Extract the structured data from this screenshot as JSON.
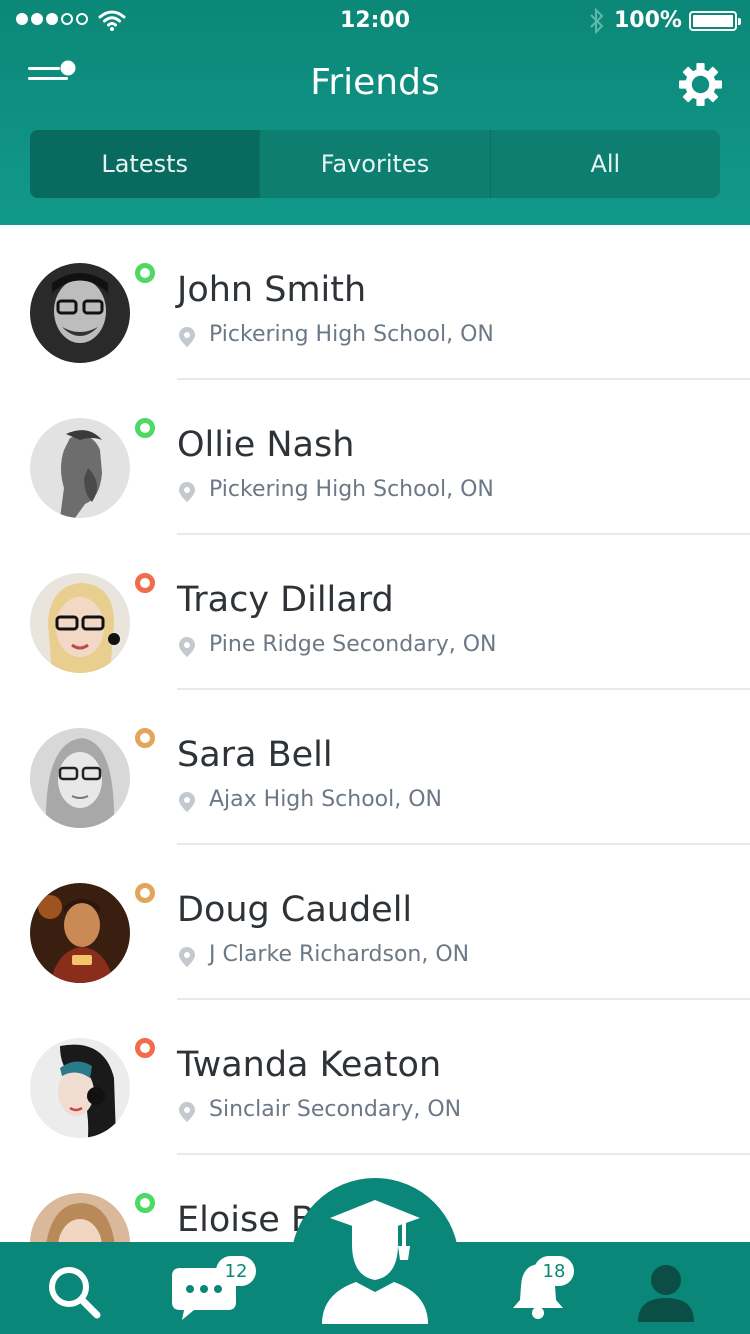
{
  "status_bar": {
    "time": "12:00",
    "battery_percent": "100%",
    "signal_bars_filled": 3,
    "signal_bars_total": 5
  },
  "header": {
    "title": "Friends",
    "menu_icon": "menu-icon",
    "settings_icon": "gear-icon"
  },
  "tabs": [
    {
      "label": "Latests",
      "active": true
    },
    {
      "label": "Favorites",
      "active": false
    },
    {
      "label": "All",
      "active": false
    }
  ],
  "friends": [
    {
      "name": "John Smith",
      "location": "Pickering High School, ON",
      "status_color": "#4cd964"
    },
    {
      "name": "Ollie Nash",
      "location": "Pickering High School, ON",
      "status_color": "#4cd964"
    },
    {
      "name": "Tracy Dillard",
      "location": "Pine Ridge Secondary, ON",
      "status_color": "#f26b4a"
    },
    {
      "name": "Sara Bell",
      "location": "Ajax High School, ON",
      "status_color": "#e2a55a"
    },
    {
      "name": "Doug Caudell",
      "location": "J Clarke Richardson, ON",
      "status_color": "#e2a55a"
    },
    {
      "name": "Twanda Keaton",
      "location": "Sinclair Secondary, ON",
      "status_color": "#f26b4a"
    },
    {
      "name": "Eloise B",
      "location": "",
      "status_color": "#4cd964"
    }
  ],
  "bottom_nav": {
    "search_icon": "search-icon",
    "messages_icon": "chat-icon",
    "messages_badge": "12",
    "center_icon": "graduate-icon",
    "notifications_icon": "bell-icon",
    "notifications_badge": "18",
    "profile_icon": "user-icon"
  },
  "colors": {
    "header": "#0b8777",
    "tab_active": "#096a5f",
    "online": "#4cd964",
    "busy": "#f26b4a",
    "away": "#e2a55a"
  }
}
